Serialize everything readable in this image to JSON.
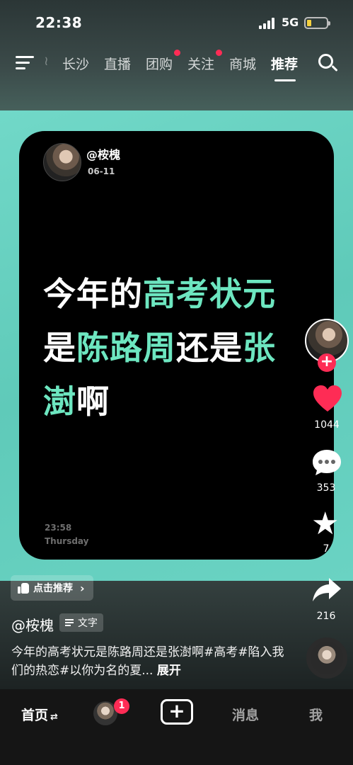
{
  "status_bar": {
    "time": "22:38",
    "network": "5G",
    "battery_level": 0.15
  },
  "nav": {
    "tabs": [
      {
        "label": "长沙",
        "active": false,
        "dot": false
      },
      {
        "label": "直播",
        "active": false,
        "dot": false
      },
      {
        "label": "团购",
        "active": false,
        "dot": true
      },
      {
        "label": "关注",
        "active": false,
        "dot": true
      },
      {
        "label": "商城",
        "active": false,
        "dot": false
      },
      {
        "label": "推荐",
        "active": true,
        "dot": false
      }
    ]
  },
  "card": {
    "author": "@桉槐",
    "date": "06-11",
    "headline_segments": [
      {
        "text": "今年的",
        "highlight": false
      },
      {
        "text": "高考状元",
        "highlight": true
      },
      {
        "text": "是",
        "highlight": false
      },
      {
        "text": "陈路周",
        "highlight": true
      },
      {
        "text": "还是",
        "highlight": false
      },
      {
        "text": "张澍",
        "highlight": true
      },
      {
        "text": "啊",
        "highlight": false
      }
    ],
    "clock": "23:58",
    "weekday": "Thursday"
  },
  "rail": {
    "likes": "1044",
    "comments": "353",
    "favorites": "7",
    "shares": "216"
  },
  "recommend_pill": {
    "label": "点击推荐"
  },
  "post": {
    "author": "@桉槐",
    "tag": "文字",
    "description": "今年的高考状元是陈路周还是张澍啊#高考#陷入我们的热恋#以你为名的夏...",
    "expand": "展开"
  },
  "bottom_nav": {
    "home": "首页",
    "friends_badge": "1",
    "add": "+",
    "messages": "消息",
    "me": "我"
  },
  "colors": {
    "accent_green": "#6de6c0",
    "brand_red": "#fe2c55",
    "teal_bg": "#66cfbf"
  }
}
